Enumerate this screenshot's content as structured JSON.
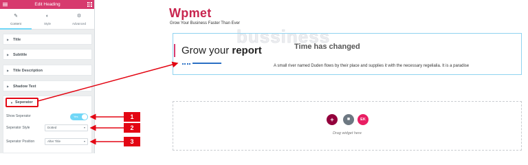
{
  "panel": {
    "title": "Edit Heading",
    "tabs": [
      {
        "label": "Content",
        "icon": "pencil-icon"
      },
      {
        "label": "Style",
        "icon": "half-circle-icon"
      },
      {
        "label": "Advanced",
        "icon": "gear-icon"
      }
    ],
    "sections": [
      "Title",
      "Subtitle",
      "Title Description",
      "Shadow Text"
    ],
    "separator": {
      "label": "Seperator",
      "show_label": "Show Seperator",
      "toggle_text": "Yes",
      "style_label": "Seperator Style",
      "style_value": "Dotted",
      "position_label": "Seperator Position",
      "position_value": "After Title"
    }
  },
  "preview": {
    "brand": "Wpmet",
    "tagline": "Grow Your Business Faster Than Ever",
    "watermark": "bussiness",
    "heading_normal": "Grow your",
    "heading_bold": "report",
    "shadow_text": "Time has changed",
    "description": "A small river named Duden flows by their place and supplies it with the necessary regelialia. It is a paradise",
    "drag_text": "Drag widget here"
  },
  "annotations": [
    "1",
    "2",
    "3"
  ],
  "colors": {
    "header": "#d73a6e",
    "accent": "#71d7f7",
    "annotation": "#e30613",
    "separator": "#2a6fc4",
    "brand": "#c8254f"
  }
}
